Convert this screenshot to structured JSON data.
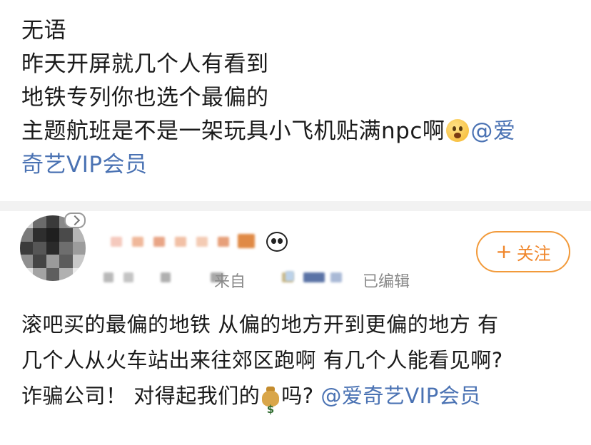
{
  "post": {
    "lines": [
      "无语",
      "昨天开屏就几个人有看到",
      "地铁专列你也选个最偏的",
      "主题航班是不是一架玩具小飞机贴满npc啊",
      "奇艺VIP会员"
    ],
    "mention_part1": "@爱",
    "emoji": "astonished-face-emoji"
  },
  "comment": {
    "user": {
      "name_redacted": true,
      "verified_icon": "panda-emoji-icon",
      "badge_icon": "chevron-badge-icon"
    },
    "meta": {
      "time_partial": "-25 12:43",
      "from_label": "来自",
      "edited_label": "已编辑"
    },
    "follow_button": {
      "plus": "+",
      "label": "关注"
    },
    "lines": [
      "滚吧买的最偏的地铁 从偏的地方开到更偏的地方 有",
      "几个人从火车站出来往郊区跑啊 有几个人能看见啊?",
      "诈骗公司！ 对得起我们的",
      "吗? ",
      "@爱奇艺VIP会员"
    ],
    "money_emoji": "money-bag-emoji"
  },
  "colors": {
    "mention": "#4a72b3",
    "follow_accent": "#f0862a",
    "meta_gray": "#999999",
    "divider": "#f2f2f2"
  }
}
